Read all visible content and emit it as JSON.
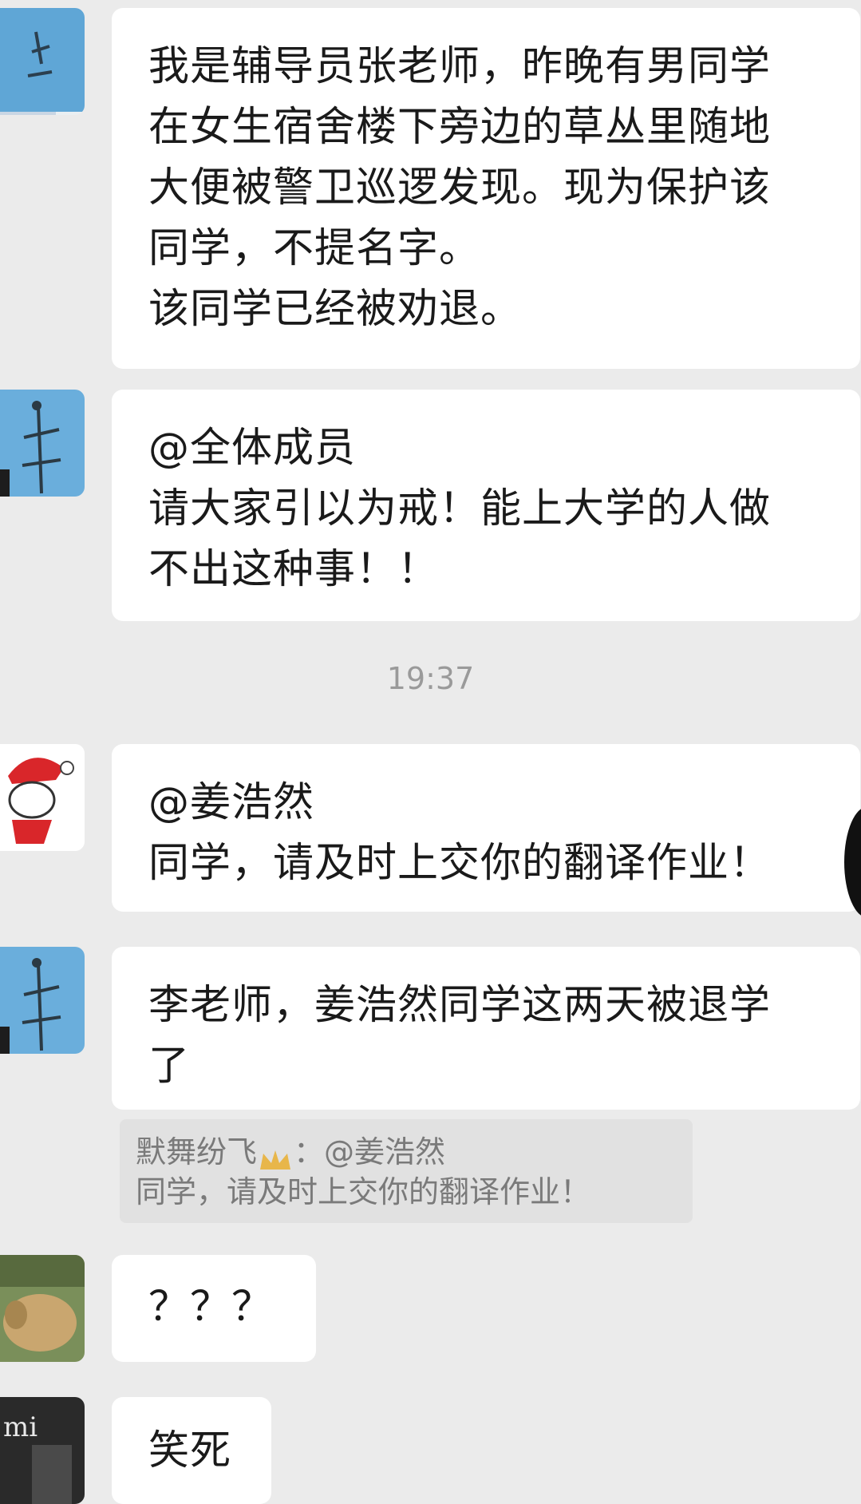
{
  "messages": [
    {
      "lines": [
        "我是辅导员张老师，昨晚有男同学",
        "在女生宿舍楼下旁边的草丛里随地",
        "大便被警卫巡逻发现。现为保护该",
        "同学，不提名字。",
        "该同学已经被劝退。"
      ]
    },
    {
      "lines": [
        "@全体成员",
        "请大家引以为戒！能上大学的人做",
        "不出这种事！！"
      ]
    },
    {
      "lines": [
        "@姜浩然",
        "同学，请及时上交你的翻译作业！"
      ]
    },
    {
      "lines": [
        "李老师，姜浩然同学这两天被退学",
        "了"
      ]
    },
    {
      "lines": [
        "？？？"
      ]
    },
    {
      "lines": [
        "笑死"
      ]
    }
  ],
  "timestamp": "19:37",
  "quote": {
    "sender": "默舞纷飞",
    "separator": "：@姜浩然",
    "text": "同学，请及时上交你的翻译作业！"
  },
  "avatar_text_mi": "mi",
  "colors": {
    "background": "#ebebeb",
    "bubble": "#ffffff",
    "quote_bg": "#e1e1e1",
    "timestamp": "#9a9a9a"
  }
}
